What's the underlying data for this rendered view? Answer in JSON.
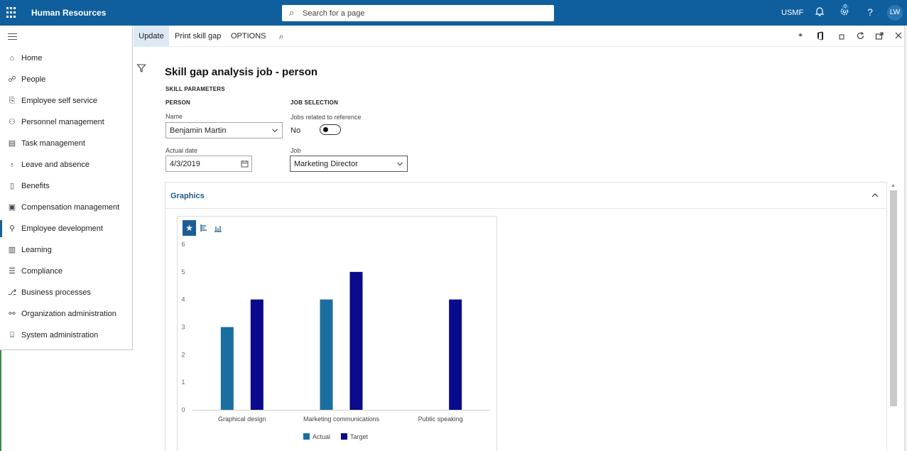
{
  "app": {
    "title": "Human Resources",
    "company": "USMF",
    "user_initials": "LW"
  },
  "search": {
    "placeholder": "Search for a page"
  },
  "notifications": {
    "count": "0"
  },
  "sidebar": {
    "items": [
      {
        "label": "Home",
        "icon": "home-icon"
      },
      {
        "label": "People",
        "icon": "people-icon"
      },
      {
        "label": "Employee self service",
        "icon": "self-service-icon"
      },
      {
        "label": "Personnel management",
        "icon": "personnel-icon"
      },
      {
        "label": "Task management",
        "icon": "task-icon"
      },
      {
        "label": "Leave and absence",
        "icon": "leave-icon"
      },
      {
        "label": "Benefits",
        "icon": "benefits-icon"
      },
      {
        "label": "Compensation management",
        "icon": "compensation-icon"
      },
      {
        "label": "Employee development",
        "icon": "development-icon"
      },
      {
        "label": "Learning",
        "icon": "learning-icon"
      },
      {
        "label": "Compliance",
        "icon": "compliance-icon"
      },
      {
        "label": "Business processes",
        "icon": "business-process-icon"
      },
      {
        "label": "Organization administration",
        "icon": "org-admin-icon"
      },
      {
        "label": "System administration",
        "icon": "system-admin-icon"
      }
    ],
    "active_index": 8
  },
  "actionpane": {
    "update": "Update",
    "print_skill_gap": "Print skill gap",
    "options": "OPTIONS"
  },
  "form": {
    "title": "Skill gap analysis job - person",
    "skill_parameters": "SKILL PARAMETERS",
    "person_group": "PERSON",
    "name_label": "Name",
    "name_value": "Benjamin Martin",
    "actual_date_label": "Actual date",
    "actual_date_value": "4/3/2019",
    "job_selection_group": "JOB SELECTION",
    "jobs_related_label": "Jobs related to reference",
    "jobs_related_value": "No",
    "job_label": "Job",
    "job_value": "Marketing Director"
  },
  "graphics": {
    "title": "Graphics"
  },
  "colors": {
    "actual": "#1b6fa0",
    "target": "#0a0a8c",
    "topbar": "#0f5f9e"
  },
  "chart_data": {
    "type": "bar",
    "categories": [
      "Graphical design",
      "Marketing communications",
      "Public speaking"
    ],
    "series": [
      {
        "name": "Actual",
        "values": [
          3,
          4,
          null
        ]
      },
      {
        "name": "Target",
        "values": [
          4,
          5,
          4
        ]
      }
    ],
    "ylim": [
      0,
      6
    ],
    "yticks": [
      0,
      1,
      2,
      3,
      4,
      5,
      6
    ],
    "legend": "bottom",
    "grid": false
  }
}
